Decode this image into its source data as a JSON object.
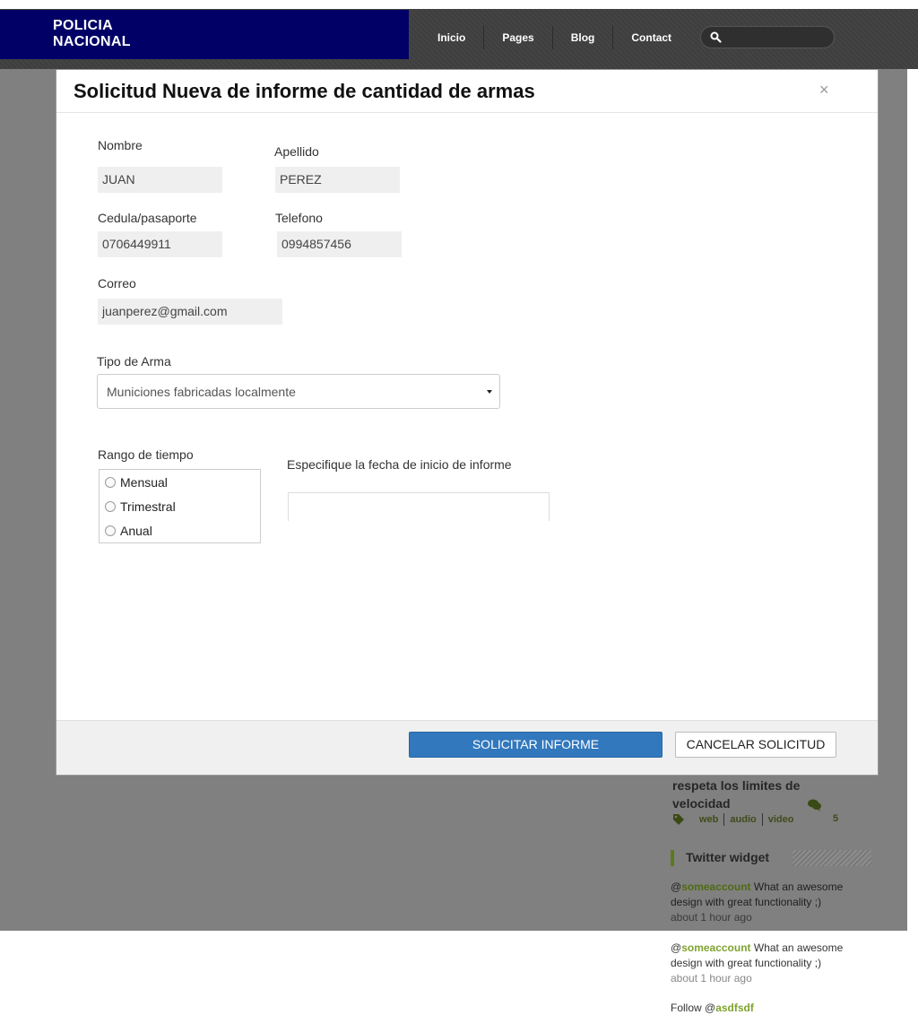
{
  "site": {
    "logo_line1": "POLICIA",
    "logo_line2": "NACIONAL",
    "nav": [
      "Inicio",
      "Pages",
      "Blog",
      "Contact"
    ],
    "search_icon": "search-icon"
  },
  "sidebar": {
    "post_title": "respeta los limites de velocidad",
    "tags": [
      "web",
      "audio",
      "video"
    ],
    "comment_count": "5",
    "widget_title": "Twitter widget",
    "tweets": [
      {
        "at": "@",
        "account": "someaccount",
        "text": " What an awesome design with great functionality ;)",
        "time": "about 1 hour ago"
      },
      {
        "at": "@",
        "account": "someaccount",
        "text": " What an awesome design with great functionality ;)",
        "time": "about 1 hour ago"
      }
    ],
    "follow_prefix": "Follow @",
    "follow_account": "asdfsdf"
  },
  "modal": {
    "title": "Solicitud Nueva de informe de cantidad de armas",
    "close": "×",
    "fields": {
      "nombre_label": "Nombre",
      "nombre_value": "JUAN",
      "apellido_label": "Apellido",
      "apellido_value": "PEREZ",
      "cedula_label": "Cedula/pasaporte",
      "cedula_value": "0706449911",
      "telefono_label": "Telefono",
      "telefono_value": "0994857456",
      "correo_label": "Correo",
      "correo_value": "juanperez@gmail.com"
    },
    "tipo_arma_label": "Tipo de Arma",
    "tipo_arma_value": "Municiones fabricadas localmente",
    "rango_label": "Rango de tiempo",
    "rango_options": [
      "Mensual",
      "Trimestral",
      "Anual"
    ],
    "fecha_label": "Especifique la fecha de inicio de informe",
    "fecha_value": "",
    "submit_label": "SOLICITAR INFORME",
    "cancel_label": "CANCELAR SOLICITUD"
  }
}
